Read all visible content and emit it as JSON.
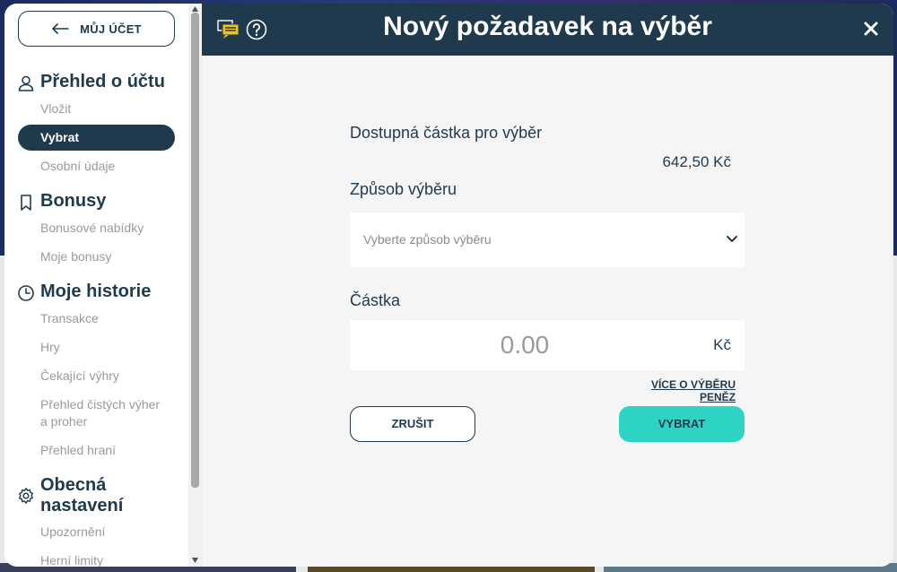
{
  "sidebar": {
    "account_button": "MŮJ ÚČET",
    "sections": [
      {
        "title": "Přehled o účtu",
        "icon": "user-icon",
        "items": [
          "Vložit",
          "Vybrat",
          "Osobní údaje"
        ]
      },
      {
        "title": "Bonusy",
        "icon": "bookmark-icon",
        "items": [
          "Bonusové nabídky",
          "Moje bonusy"
        ]
      },
      {
        "title": "Moje historie",
        "icon": "clock-icon",
        "items": [
          "Transakce",
          "Hry",
          "Čekající výhry",
          "Přehled čistých výher",
          "a proher",
          "Přehled hraní"
        ]
      },
      {
        "title_line1": "Obecná",
        "title_line2": "nastavení",
        "icon": "gear-icon",
        "items": [
          "Upozornění",
          "Herní limity"
        ]
      }
    ],
    "active_item": "Vybrat"
  },
  "header": {
    "title": "Nový požadavek na výběr",
    "chat_icon": "chat-icon",
    "help_icon": "help-icon",
    "close_icon": "close-icon"
  },
  "form": {
    "available_label": "Dostupná částka pro výběr",
    "available_amount": "642,50 Kč",
    "method_label": "Způsob výběru",
    "method_placeholder": "Vyberte způsob výběru",
    "amount_label": "Částka",
    "amount_value": "0.00",
    "currency": "Kč",
    "more_link": "VÍCE O VÝBĚRU PENĚZ",
    "cancel_button": "ZRUŠIT",
    "submit_button": "VYBRAT"
  },
  "colors": {
    "primary": "#1f3a4d",
    "accent": "#2dd4c4",
    "muted": "#9a9a9a"
  }
}
